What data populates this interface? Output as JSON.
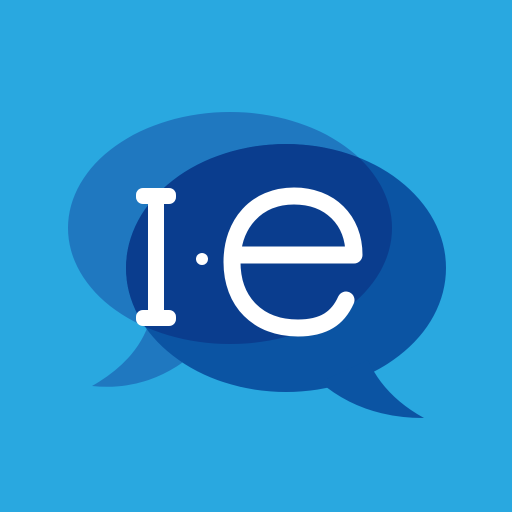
{
  "icon": {
    "name": "chat-bubbles-logo",
    "lettering": "I·e",
    "colors": {
      "background": "#29a8e0",
      "back_bubble": "#1f78c0",
      "front_bubble": "#0b54a3",
      "overlap": "#0a3d8e",
      "letters": "#ffffff"
    }
  }
}
